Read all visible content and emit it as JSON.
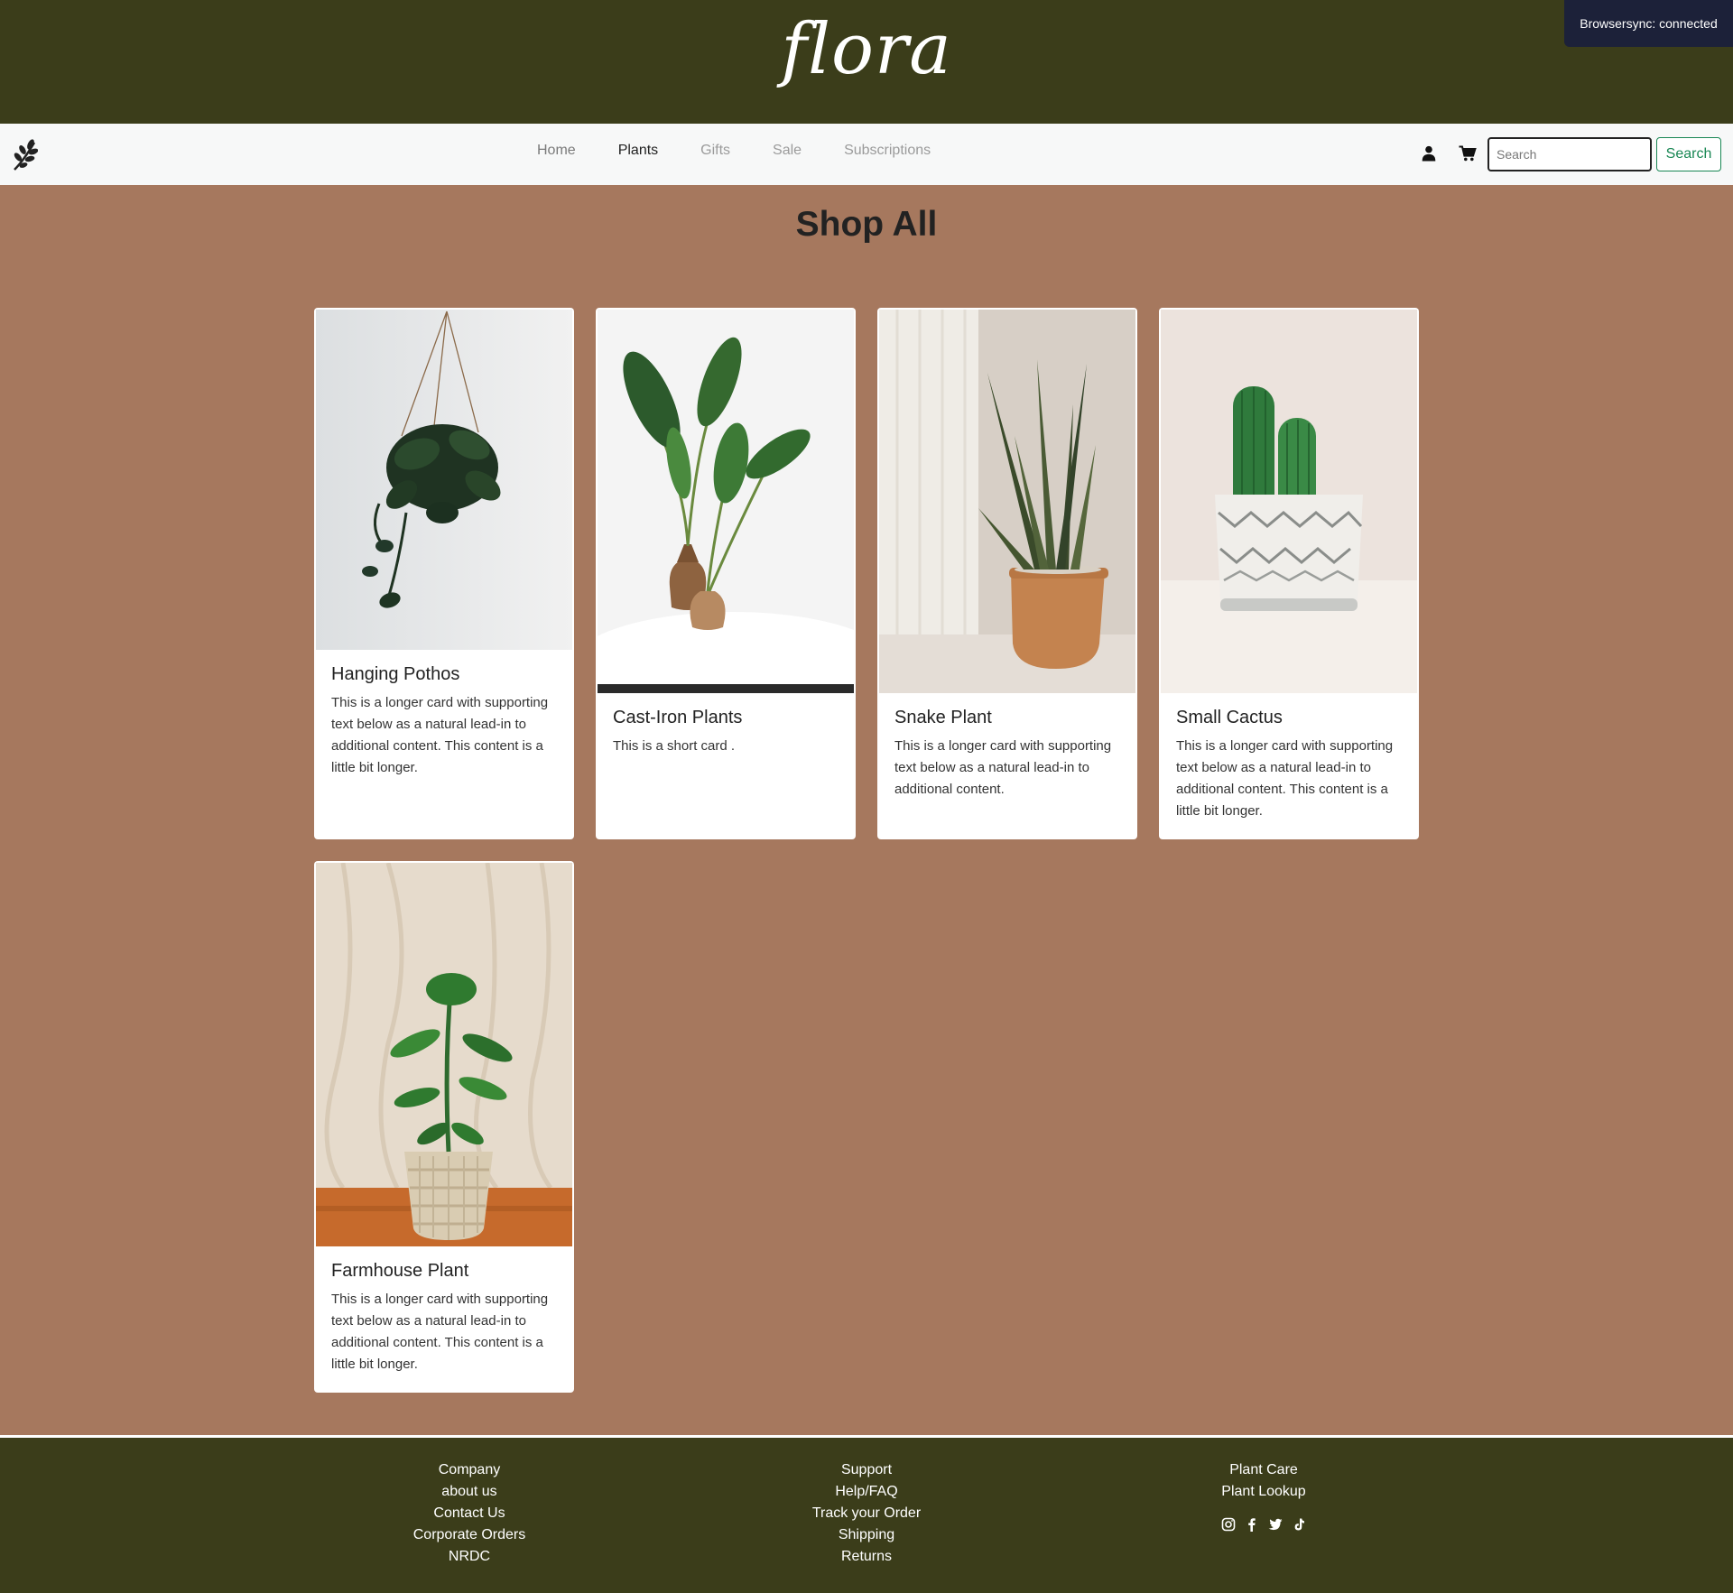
{
  "header": {
    "brand": "flora"
  },
  "browsersync": {
    "text": "Browsersync: connected"
  },
  "nav": {
    "links": [
      {
        "label": "Home"
      },
      {
        "label": "Plants"
      },
      {
        "label": "Gifts"
      },
      {
        "label": "Sale"
      },
      {
        "label": "Subscriptions"
      }
    ],
    "search_placeholder": "Search",
    "search_button": "Search"
  },
  "page": {
    "title": "Shop All"
  },
  "products": [
    {
      "title": "Hanging Pothos",
      "text": "This is a longer card with supporting text below as a natural lead-in to additional content. This content is a little bit longer."
    },
    {
      "title": "Cast-Iron Plants",
      "text": "This is a short card ."
    },
    {
      "title": "Snake Plant",
      "text": "This is a longer card with supporting text below as a natural lead-in to additional content."
    },
    {
      "title": "Small Cactus",
      "text": "This is a longer card with supporting text below as a natural lead-in to additional content. This content is a little bit longer."
    },
    {
      "title": "Farmhouse Plant",
      "text": "This is a longer card with supporting text below as a natural lead-in to additional content. This content is a little bit longer."
    }
  ],
  "footer": {
    "company": [
      "Company",
      "about us",
      "Contact Us",
      "Corporate Orders",
      "NRDC"
    ],
    "support": [
      "Support",
      "Help/FAQ",
      "Track your Order",
      "Shipping",
      "Returns"
    ],
    "plant_care": [
      "Plant Care",
      "Plant Lookup"
    ],
    "socials": [
      "instagram-icon",
      "facebook-icon",
      "twitter-icon",
      "tiktok-icon"
    ]
  },
  "colors": {
    "header_bg": "#3b3d1a",
    "page_bg": "#a6785e",
    "navbar_bg": "#f7f8f8",
    "search_accent": "#198754"
  }
}
